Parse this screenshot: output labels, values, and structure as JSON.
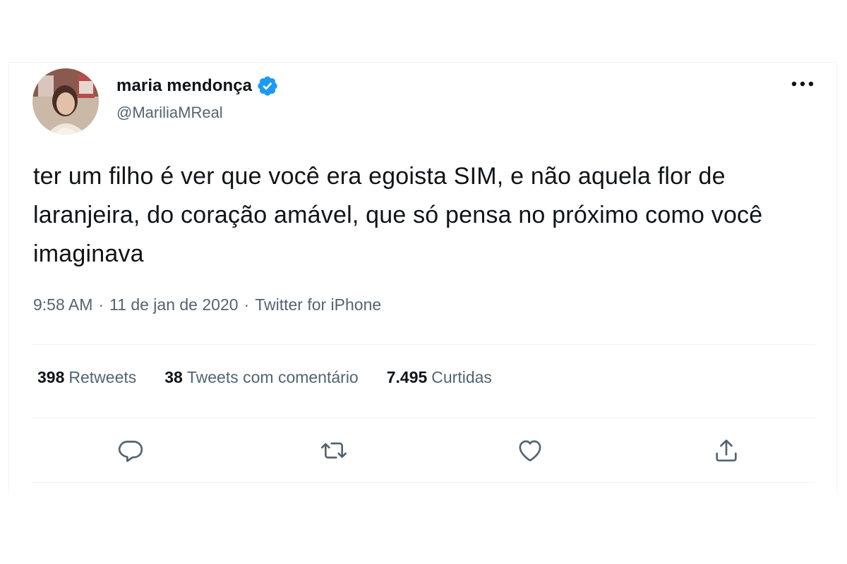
{
  "author": {
    "name": "maria mendonça",
    "handle": "@MariliaMReal",
    "verified": true,
    "verified_color": "#1d9bf0"
  },
  "tweet": {
    "text": "ter um filho é ver que você era egoista SIM, e não aquela flor de laranjeira, do coração amável, que só pensa no próximo como você imaginava",
    "time": "9:58 AM",
    "separator": "·",
    "date": "11 de jan de 2020",
    "source": "Twitter for iPhone"
  },
  "stats": {
    "retweets": {
      "count": "398",
      "label": "Retweets"
    },
    "quotes": {
      "count": "38",
      "label": "Tweets com comentário"
    },
    "likes": {
      "count": "7.495",
      "label": "Curtidas"
    }
  },
  "actions": {
    "reply_icon": "reply-icon",
    "retweet_icon": "retweet-icon",
    "like_icon": "heart-icon",
    "share_icon": "share-icon"
  },
  "colors": {
    "text_primary": "#0f1419",
    "text_secondary": "#536471",
    "divider": "#eff3f4",
    "icon": "#536471"
  }
}
